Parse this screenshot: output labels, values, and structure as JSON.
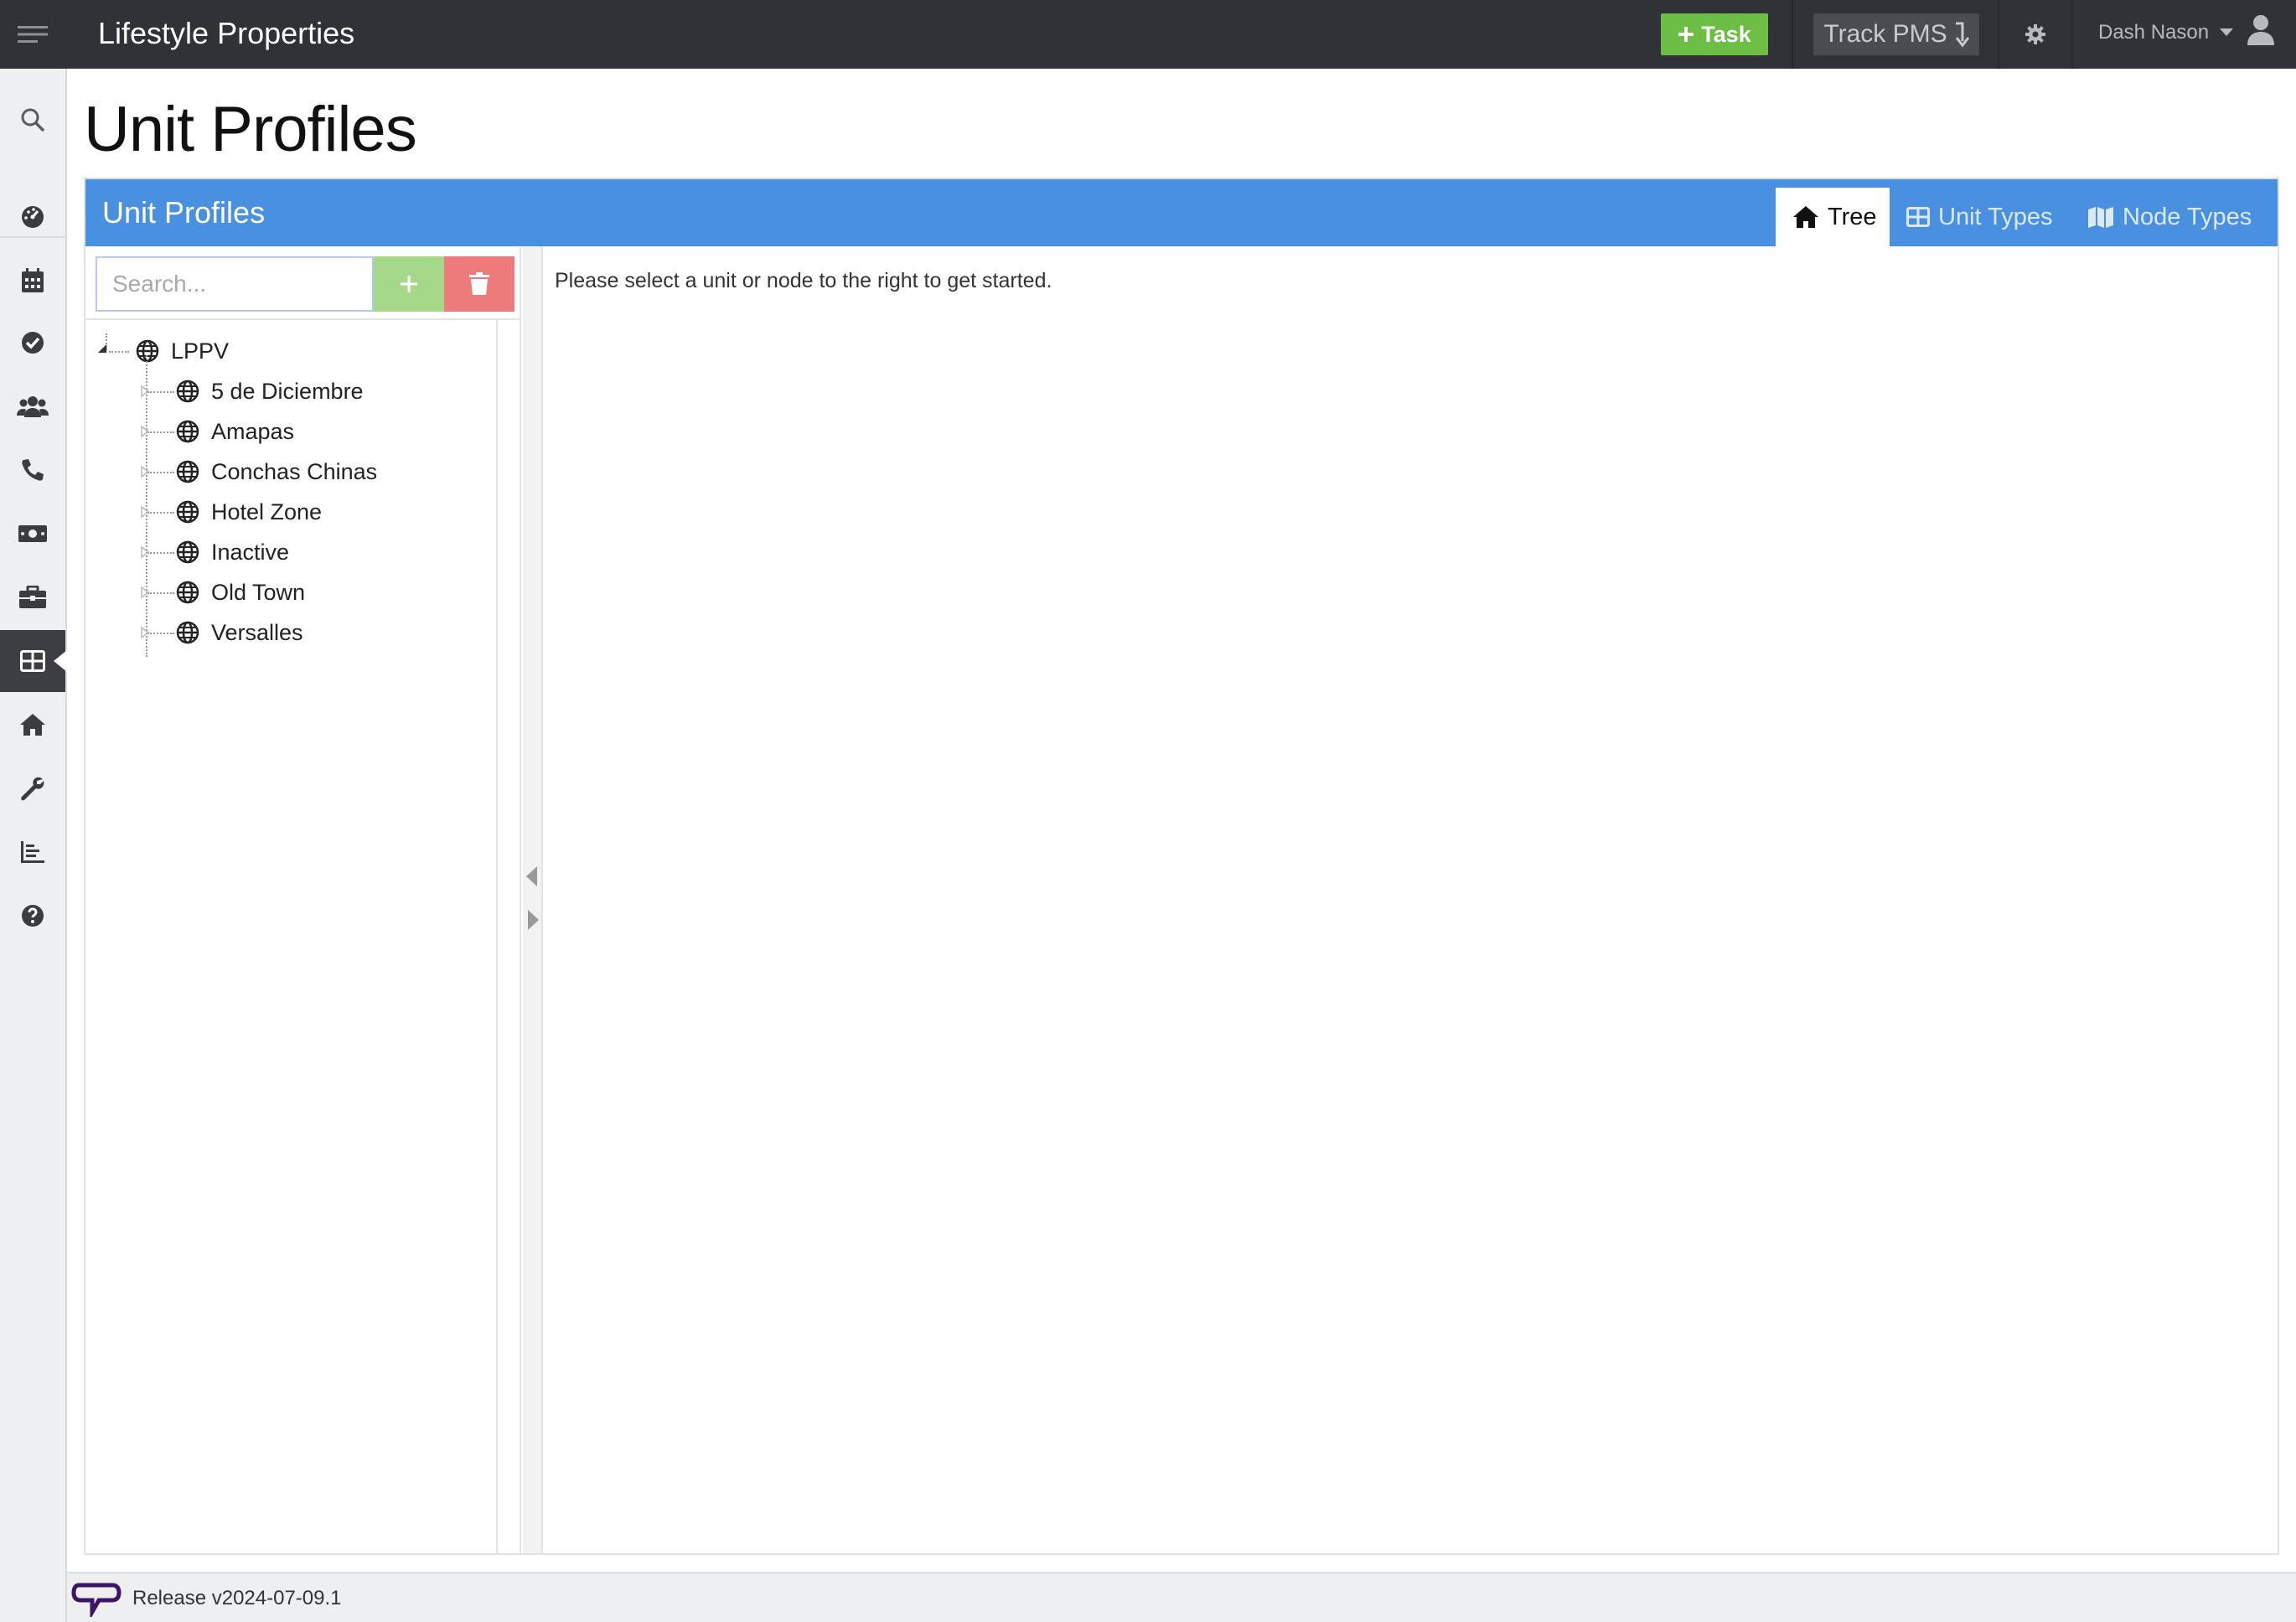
{
  "header": {
    "app_title": "Lifestyle Properties",
    "task_label": "Task",
    "track_label": "Track PMS",
    "user_name": "Dash Nason"
  },
  "page": {
    "title": "Unit Profiles"
  },
  "panel": {
    "title": "Unit Profiles",
    "tabs": [
      {
        "label": "Tree",
        "icon": "home-icon",
        "active": true
      },
      {
        "label": "Unit Types",
        "icon": "grid-icon",
        "active": false
      },
      {
        "label": "Node Types",
        "icon": "map-icon",
        "active": false
      }
    ]
  },
  "tree": {
    "search_placeholder": "Search...",
    "root": {
      "label": "LPPV",
      "icon": "globe-icon"
    },
    "children": [
      {
        "label": "5 de Diciembre",
        "icon": "globe-icon"
      },
      {
        "label": "Amapas",
        "icon": "globe-icon"
      },
      {
        "label": "Conchas Chinas",
        "icon": "globe-icon"
      },
      {
        "label": "Hotel Zone",
        "icon": "globe-icon"
      },
      {
        "label": "Inactive",
        "icon": "globe-icon"
      },
      {
        "label": "Old Town",
        "icon": "globe-icon"
      },
      {
        "label": "Versalles",
        "icon": "globe-icon"
      }
    ]
  },
  "main": {
    "message": "Please select a unit or node to the right to get started."
  },
  "footer": {
    "release": "Release v2024-07-09.1"
  },
  "colors": {
    "topbar": "#303238",
    "accent_blue": "#4a90e0",
    "task_green": "#6dbe45",
    "add_green": "#a6d88a",
    "delete_red": "#ee7b7b"
  }
}
